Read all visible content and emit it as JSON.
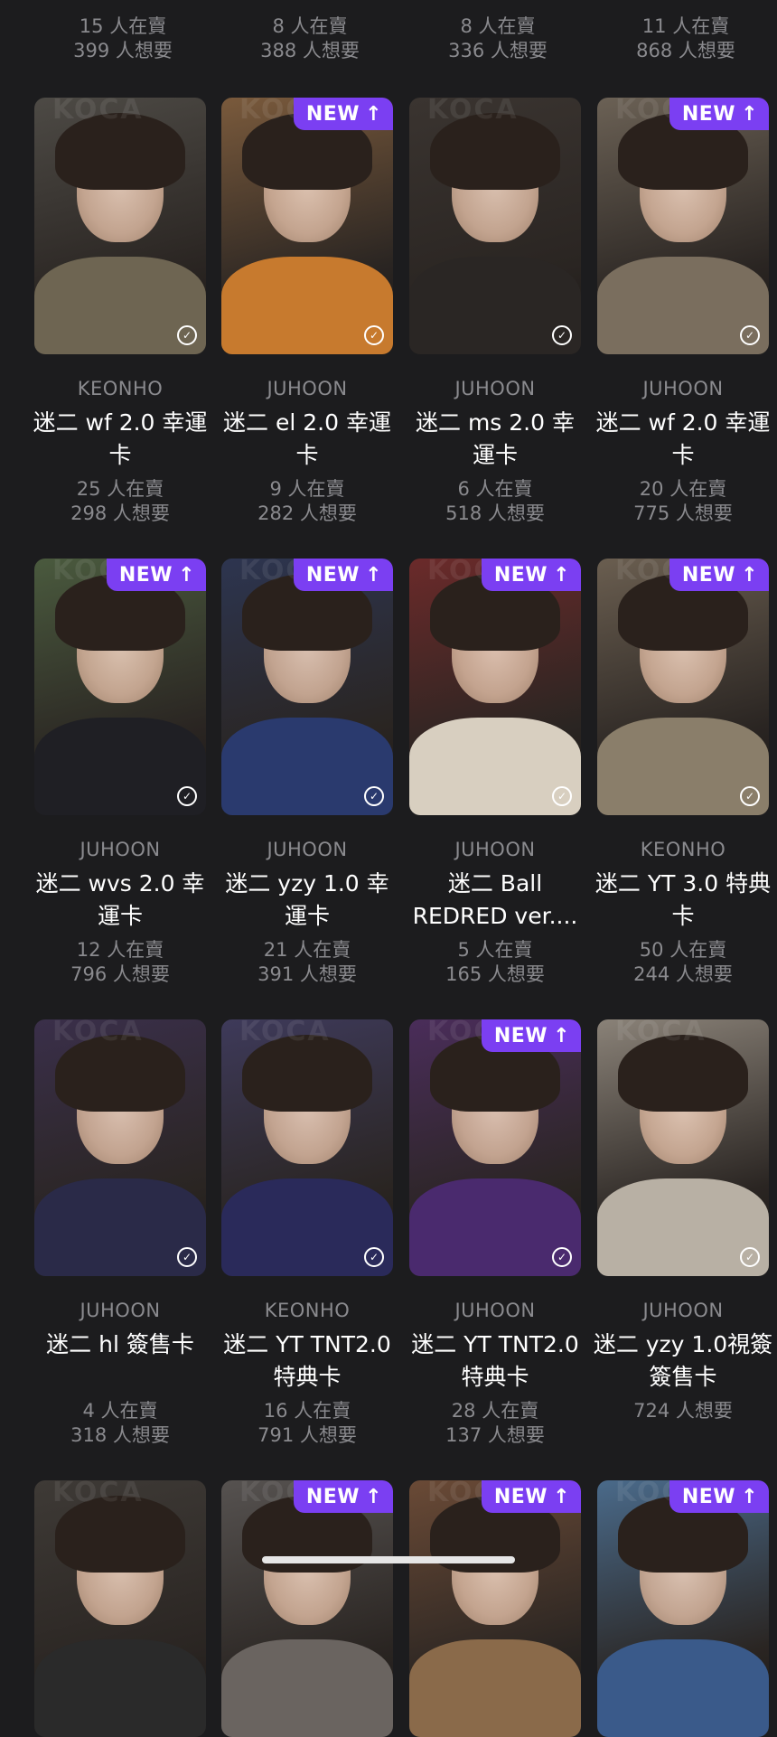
{
  "colors": {
    "background": "#1c1c1e",
    "badge": "#7b3ff2",
    "muted_text": "#8a8a8e"
  },
  "top_row": [
    {
      "sellers": "15 人在賣",
      "wanted": "399 人想要"
    },
    {
      "sellers": "8 人在賣",
      "wanted": "388 人想要"
    },
    {
      "sellers": "8 人在賣",
      "wanted": "336 人想要"
    },
    {
      "sellers": "11 人在賣",
      "wanted": "868 人想要"
    }
  ],
  "badge_label": "NEW",
  "badge_icon": "arrow-up-icon",
  "owned_icon": "check-circle-icon",
  "watermark_text": "KOCA",
  "cards": [
    {
      "member": "KEONHO",
      "title": "迷二 wf 2.0 幸運卡",
      "sellers": "25 人在賣",
      "wanted": "298 人想要",
      "new": false
    },
    {
      "member": "JUHOON",
      "title": "迷二 el 2.0 幸運卡",
      "sellers": "9 人在賣",
      "wanted": "282 人想要",
      "new": true
    },
    {
      "member": "JUHOON",
      "title": "迷二 ms 2.0 幸運卡",
      "sellers": "6 人在賣",
      "wanted": "518 人想要",
      "new": false
    },
    {
      "member": "JUHOON",
      "title": "迷二 wf 2.0 幸運卡",
      "sellers": "20 人在賣",
      "wanted": "775 人想要",
      "new": true
    },
    {
      "member": "JUHOON",
      "title": "迷二 wvs 2.0 幸運卡",
      "sellers": "12 人在賣",
      "wanted": "796 人想要",
      "new": true
    },
    {
      "member": "JUHOON",
      "title": "迷二 yzy 1.0 幸運卡",
      "sellers": "21 人在賣",
      "wanted": "391 人想要",
      "new": true
    },
    {
      "member": "JUHOON",
      "title": "迷二 Ball REDRED ver....",
      "sellers": "5 人在賣",
      "wanted": "165 人想要",
      "new": true
    },
    {
      "member": "KEONHO",
      "title": "迷二 YT 3.0 特典卡",
      "sellers": "50 人在賣",
      "wanted": "244 人想要",
      "new": true
    },
    {
      "member": "JUHOON",
      "title": "迷二 hl 簽售卡",
      "sellers": "4 人在賣",
      "wanted": "318 人想要",
      "new": false
    },
    {
      "member": "KEONHO",
      "title": "迷二 YT TNT2.0 特典卡",
      "sellers": "16 人在賣",
      "wanted": "791 人想要",
      "new": false
    },
    {
      "member": "JUHOON",
      "title": "迷二 YT TNT2.0 特典卡",
      "sellers": "28 人在賣",
      "wanted": "137 人想要",
      "new": true
    },
    {
      "member": "JUHOON",
      "title": "迷二 yzy 1.0視簽 簽售卡",
      "sellers": "",
      "wanted": "724 人想要",
      "new": false
    },
    {
      "member": "",
      "title": "",
      "sellers": "",
      "wanted": "",
      "new": false
    },
    {
      "member": "",
      "title": "",
      "sellers": "",
      "wanted": "",
      "new": true
    },
    {
      "member": "",
      "title": "",
      "sellers": "",
      "wanted": "",
      "new": true
    },
    {
      "member": "",
      "title": "",
      "sellers": "",
      "wanted": "",
      "new": true
    }
  ]
}
